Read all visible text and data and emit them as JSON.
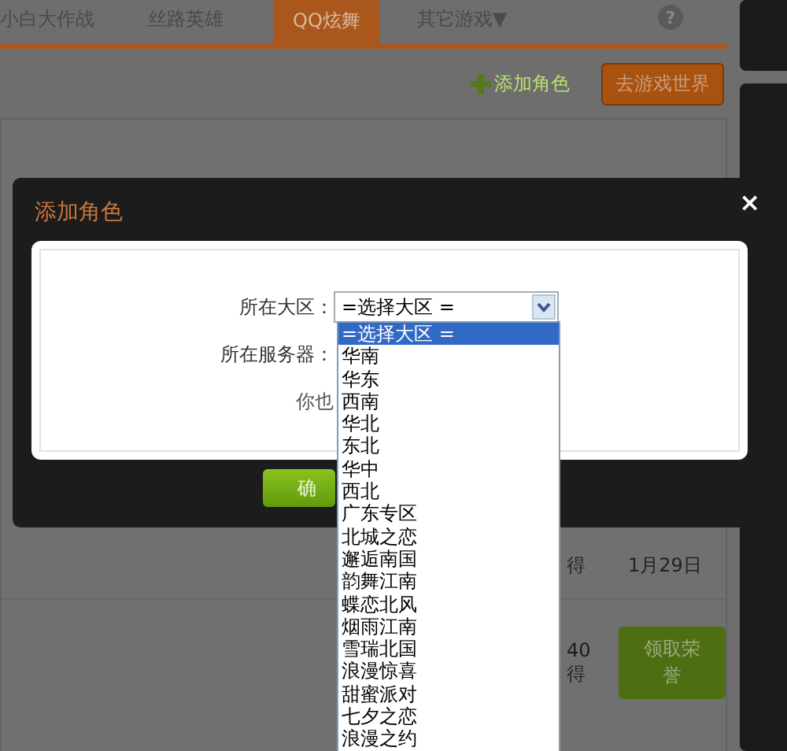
{
  "tabs": [
    {
      "label": "小白大作战",
      "selected": false
    },
    {
      "label": "丝路英雄",
      "selected": false
    },
    {
      "label": "QQ炫舞",
      "selected": true
    },
    {
      "label": "其它游戏▼",
      "selected": false
    }
  ],
  "help_button": "?",
  "toolbar": {
    "add_role": "添加角色",
    "world_button": "去游戏世界"
  },
  "rewards": [
    {
      "kind": "claimed",
      "column_1": "得",
      "date": "1月29日"
    },
    {
      "kind": "claimable",
      "points": "40",
      "column_1": "得",
      "button": "领取荣誉"
    }
  ],
  "dialog": {
    "title": "添加角色",
    "close": "×",
    "fields": [
      {
        "label": "所在大区：",
        "value": "=选择大区 ="
      },
      {
        "label": "所在服务器："
      }
    ],
    "note": "你也",
    "confirm": "确",
    "dropdown": [
      {
        "label": "=选择大区 =",
        "selected": true
      },
      {
        "label": "华南",
        "selected": false
      },
      {
        "label": "华东",
        "selected": false
      },
      {
        "label": "西南",
        "selected": false
      },
      {
        "label": "华北",
        "selected": false
      },
      {
        "label": "东北",
        "selected": false
      },
      {
        "label": "华中",
        "selected": false
      },
      {
        "label": "西北",
        "selected": false
      },
      {
        "label": "广东专区",
        "selected": false
      },
      {
        "label": "北城之恋",
        "selected": false
      },
      {
        "label": "邂逅南国",
        "selected": false
      },
      {
        "label": "韵舞江南",
        "selected": false
      },
      {
        "label": "蝶恋北风",
        "selected": false
      },
      {
        "label": "烟雨江南",
        "selected": false
      },
      {
        "label": "雪瑞北国",
        "selected": false
      },
      {
        "label": "浪漫惊喜",
        "selected": false
      },
      {
        "label": "甜蜜派对",
        "selected": false
      },
      {
        "label": "七夕之恋",
        "selected": false
      },
      {
        "label": "浪漫之约",
        "selected": false
      }
    ]
  }
}
